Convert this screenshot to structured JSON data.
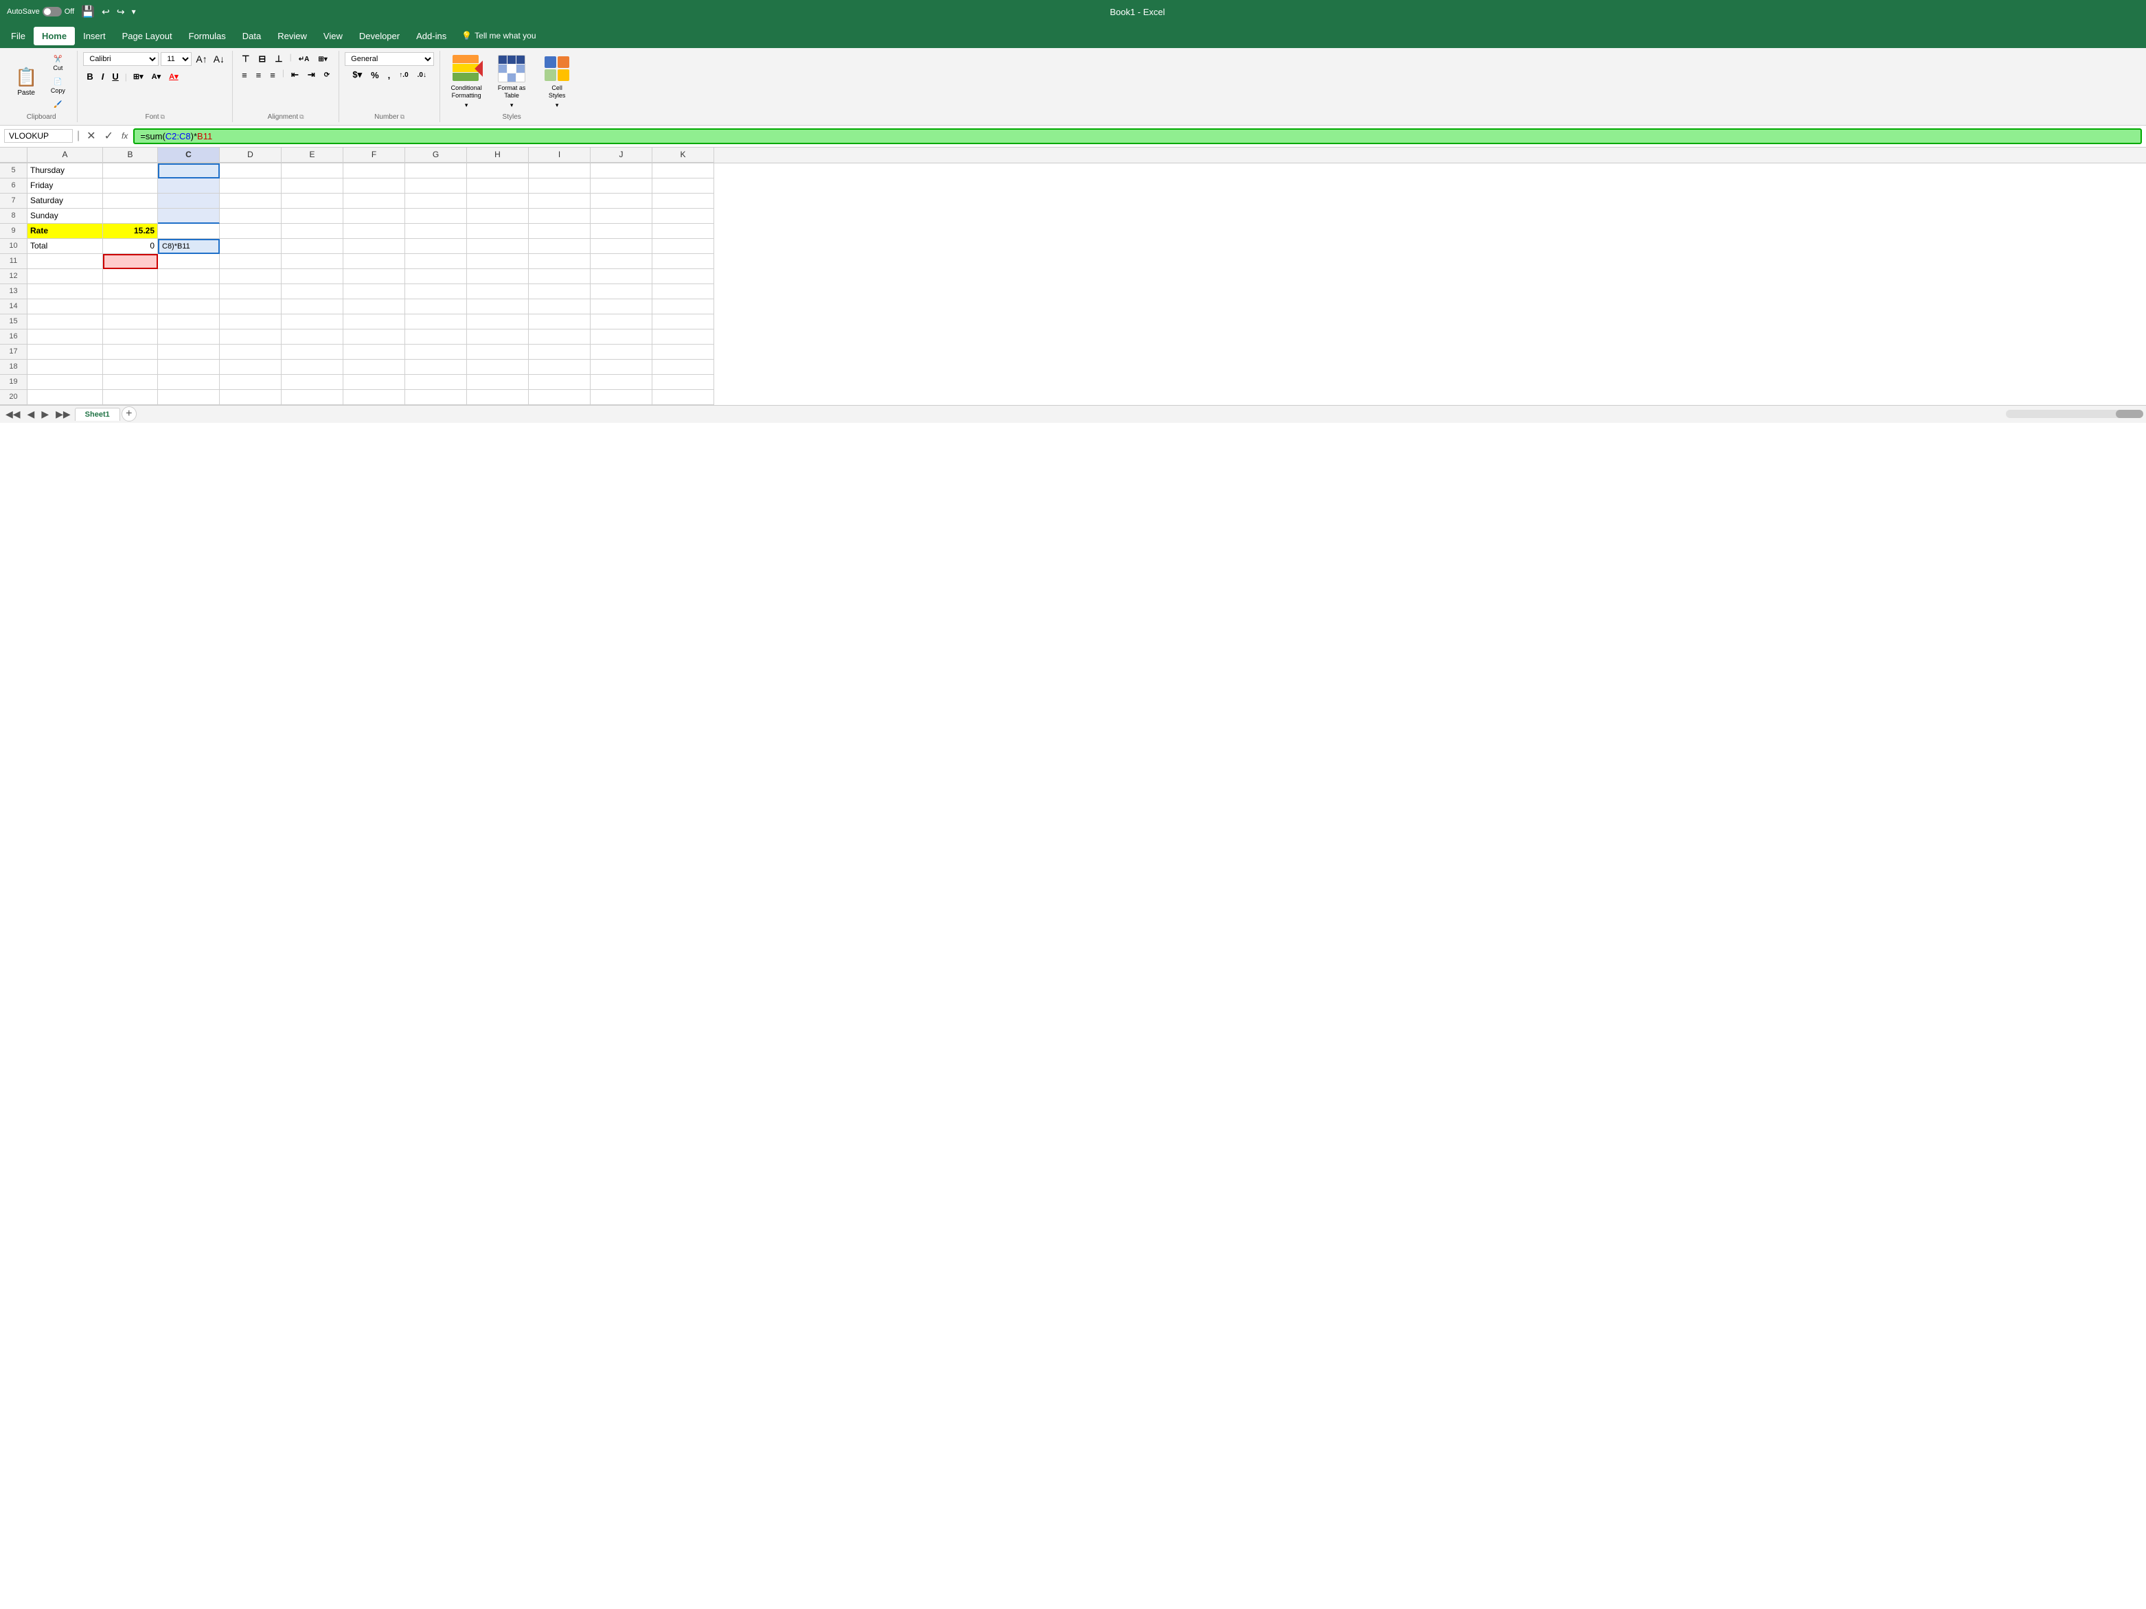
{
  "titleBar": {
    "autosave_label": "AutoSave",
    "off_label": "Off",
    "title": "Book1  -  Excel"
  },
  "menuBar": {
    "items": [
      {
        "label": "File",
        "active": false
      },
      {
        "label": "Home",
        "active": true
      },
      {
        "label": "Insert",
        "active": false
      },
      {
        "label": "Page Layout",
        "active": false
      },
      {
        "label": "Formulas",
        "active": false
      },
      {
        "label": "Data",
        "active": false
      },
      {
        "label": "Review",
        "active": false
      },
      {
        "label": "View",
        "active": false
      },
      {
        "label": "Developer",
        "active": false
      },
      {
        "label": "Add-ins",
        "active": false
      }
    ],
    "tell_me": "Tell me what you"
  },
  "ribbon": {
    "groups": [
      {
        "label": "Clipboard",
        "id": "clipboard"
      },
      {
        "label": "Font",
        "id": "font"
      },
      {
        "label": "Alignment",
        "id": "alignment"
      },
      {
        "label": "Number",
        "id": "number"
      },
      {
        "label": "Styles",
        "id": "styles"
      }
    ],
    "clipboard": {
      "paste_label": "Paste",
      "cut_label": "Cut",
      "copy_label": "Copy",
      "format_painter_label": "Format Painter"
    },
    "font": {
      "font_name": "Calibri",
      "font_size": "11",
      "bold": "B",
      "italic": "I",
      "underline": "U"
    },
    "number": {
      "format": "General"
    },
    "styles": {
      "conditional_label": "Conditional\nFormatting",
      "format_table_label": "Format as\nTable",
      "cell_styles_label": "Cell\nStyles"
    }
  },
  "formulaBar": {
    "name_box": "VLOOKUP",
    "formula": "=sum(C2:C8)*B11",
    "formula_c2c8": "C2:C8",
    "formula_b11": "B11"
  },
  "columns": [
    "A",
    "B",
    "C",
    "D",
    "E",
    "F",
    "G",
    "H",
    "I",
    "J",
    "K"
  ],
  "rows": [
    {
      "num": 5,
      "cells": {
        "A": "Thursday",
        "B": "",
        "C": "",
        "D": "",
        "E": "",
        "F": "",
        "G": "",
        "H": "",
        "I": "",
        "J": "",
        "K": ""
      }
    },
    {
      "num": 6,
      "cells": {
        "A": "Friday",
        "B": "",
        "C": "",
        "D": "",
        "E": "",
        "F": "",
        "G": "",
        "H": "",
        "I": "",
        "J": "",
        "K": ""
      }
    },
    {
      "num": 7,
      "cells": {
        "A": "Saturday",
        "B": "",
        "C": "",
        "D": "",
        "E": "",
        "F": "",
        "G": "",
        "H": "",
        "I": "",
        "J": "",
        "K": ""
      }
    },
    {
      "num": 8,
      "cells": {
        "A": "Sunday",
        "B": "",
        "C": "",
        "D": "",
        "E": "",
        "F": "",
        "G": "",
        "H": "",
        "I": "",
        "J": "",
        "K": ""
      }
    },
    {
      "num": 9,
      "cells": {
        "A": "Rate",
        "B": "15.25",
        "C": "",
        "D": "",
        "E": "",
        "F": "",
        "G": "",
        "H": "",
        "I": "",
        "J": "",
        "K": ""
      }
    },
    {
      "num": 10,
      "cells": {
        "A": "Total",
        "B": "0",
        "C": "C8)*B11",
        "D": "",
        "E": "",
        "F": "",
        "G": "",
        "H": "",
        "I": "",
        "J": "",
        "K": ""
      }
    },
    {
      "num": 11,
      "cells": {
        "A": "",
        "B": "",
        "C": "",
        "D": "",
        "E": "",
        "F": "",
        "G": "",
        "H": "",
        "I": "",
        "J": "",
        "K": ""
      }
    },
    {
      "num": 12,
      "cells": {
        "A": "",
        "B": "",
        "C": "",
        "D": "",
        "E": "",
        "F": "",
        "G": "",
        "H": "",
        "I": "",
        "J": "",
        "K": ""
      }
    },
    {
      "num": 13,
      "cells": {
        "A": "",
        "B": "",
        "C": "",
        "D": "",
        "E": "",
        "F": "",
        "G": "",
        "H": "",
        "I": "",
        "J": "",
        "K": ""
      }
    },
    {
      "num": 14,
      "cells": {
        "A": "",
        "B": "",
        "C": "",
        "D": "",
        "E": "",
        "F": "",
        "G": "",
        "H": "",
        "I": "",
        "J": "",
        "K": ""
      }
    },
    {
      "num": 15,
      "cells": {
        "A": "",
        "B": "",
        "C": "",
        "D": "",
        "E": "",
        "F": "",
        "G": "",
        "H": "",
        "I": "",
        "J": "",
        "K": ""
      }
    },
    {
      "num": 16,
      "cells": {
        "A": "",
        "B": "",
        "C": "",
        "D": "",
        "E": "",
        "F": "",
        "G": "",
        "H": "",
        "I": "",
        "J": "",
        "K": ""
      }
    },
    {
      "num": 17,
      "cells": {
        "A": "",
        "B": "",
        "C": "",
        "D": "",
        "E": "",
        "F": "",
        "G": "",
        "H": "",
        "I": "",
        "J": "",
        "K": ""
      }
    },
    {
      "num": 18,
      "cells": {
        "A": "",
        "B": "",
        "C": "",
        "D": "",
        "E": "",
        "F": "",
        "G": "",
        "H": "",
        "I": "",
        "J": "",
        "K": ""
      }
    },
    {
      "num": 19,
      "cells": {
        "A": "",
        "B": "",
        "C": "",
        "D": "",
        "E": "",
        "F": "",
        "G": "",
        "H": "",
        "I": "",
        "J": "",
        "K": ""
      }
    },
    {
      "num": 20,
      "cells": {
        "A": "",
        "B": "",
        "C": "",
        "D": "",
        "E": "",
        "F": "",
        "G": "",
        "H": "",
        "I": "",
        "J": "",
        "K": ""
      }
    }
  ],
  "sheets": [
    {
      "label": "Sheet1",
      "active": true
    }
  ]
}
